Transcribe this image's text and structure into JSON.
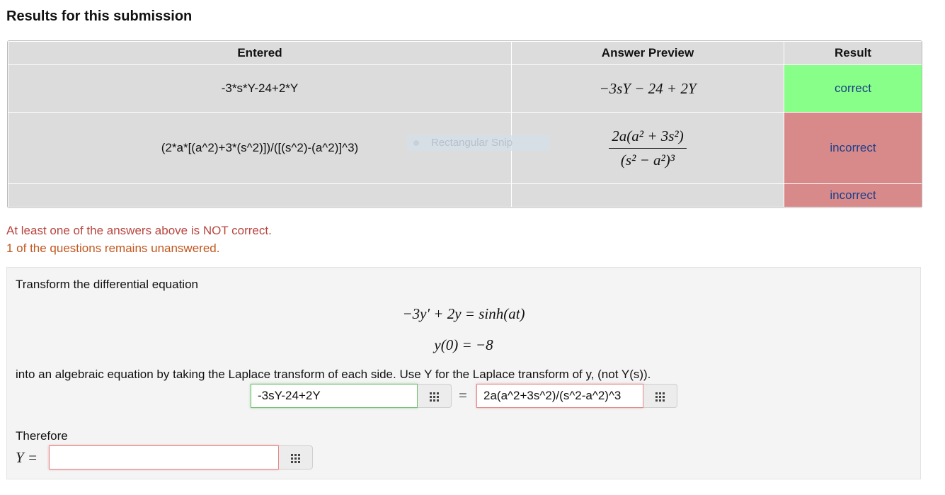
{
  "heading": "Results for this submission",
  "table": {
    "headers": [
      "Entered",
      "Answer Preview",
      "Result"
    ],
    "rows": [
      {
        "entered": "-3*s*Y-24+2*Y",
        "preview": "−3sY − 24 + 2Y",
        "result": "correct",
        "status": "correct"
      },
      {
        "entered": "(2*a*[(a^2)+3*(s^2)])/([(s^2)-(a^2)]^3)",
        "preview_num": "2a(a² + 3s²)",
        "preview_den": "(s² − a²)³",
        "result": "incorrect",
        "status": "incorrect"
      },
      {
        "entered": "",
        "preview": "",
        "result": "incorrect",
        "status": "incorrect"
      }
    ]
  },
  "overlay": {
    "snip_label": "Rectangular Snip"
  },
  "messages": {
    "not_correct": "At least one of the answers above is NOT correct.",
    "unanswered": "1 of the questions remains unanswered."
  },
  "problem": {
    "intro": "Transform the differential equation",
    "eq1": "−3y′ + 2y = sinh(at)",
    "eq2": "y(0) = −8",
    "instruction": "into an algebraic equation by taking the Laplace transform of each side. Use Y for the Laplace transform of y, (not Y(s)).",
    "answer_left": "-3sY-24+2Y",
    "equals": "=",
    "answer_right": "2a(a^2+3s^2)/(s^2-a^2)^3",
    "therefore": "Therefore",
    "y_label": "Y =",
    "answer_y": ""
  },
  "colors": {
    "correct": "#88ff88",
    "incorrect": "#d88a8a",
    "error_text": "#b8453f",
    "warn_text": "#c2571f"
  }
}
